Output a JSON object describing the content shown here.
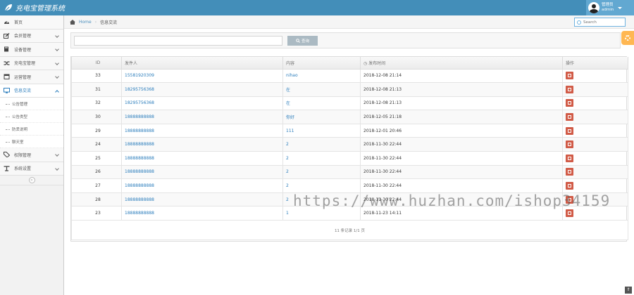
{
  "navbar": {
    "brand": "充电宝管理系统",
    "user_role": "管理员",
    "user_name": "admin"
  },
  "sidebar": {
    "items": [
      {
        "label": "首页",
        "icon": "dashboard-icon",
        "has_children": false
      },
      {
        "label": "会员管理",
        "icon": "edit-icon",
        "has_children": true
      },
      {
        "label": "设备管理",
        "icon": "book-icon",
        "has_children": true
      },
      {
        "label": "充电宝管理",
        "icon": "shuffle-icon",
        "has_children": true
      },
      {
        "label": "运营管理",
        "icon": "calendar-icon",
        "has_children": true
      },
      {
        "label": "信息交流",
        "icon": "desktop-icon",
        "has_children": true,
        "active": true
      }
    ],
    "subitems": [
      "公告管理",
      "公告类型",
      "防丢说明",
      "聊天室"
    ],
    "items_after": [
      {
        "label": "权限管理",
        "icon": "tag-icon",
        "has_children": true
      },
      {
        "label": "系统设置",
        "icon": "user-cog-icon",
        "has_children": true
      }
    ],
    "collapse_glyph": "«"
  },
  "breadcrumb": {
    "home": "Home",
    "separator": "›",
    "current": "信息交流"
  },
  "search": {
    "placeholder": "Search"
  },
  "toolbar": {
    "input_value": "",
    "query_label": "查询"
  },
  "table": {
    "columns": [
      "ID",
      "发件人",
      "内容",
      "发布时间",
      "操作"
    ],
    "rows": [
      {
        "id": "33",
        "sender": "15581920309",
        "content": "nihao",
        "time": "2018-12-08 21:14"
      },
      {
        "id": "31",
        "sender": "18295756368",
        "content": "在",
        "time": "2018-12-08 21:13"
      },
      {
        "id": "32",
        "sender": "18295756368",
        "content": "在",
        "time": "2018-12-08 21:13"
      },
      {
        "id": "30",
        "sender": "18888888888",
        "content": "你好",
        "time": "2018-12-05 21:18"
      },
      {
        "id": "29",
        "sender": "18888888888",
        "content": "111",
        "time": "2018-12-01 20:46"
      },
      {
        "id": "24",
        "sender": "18888888888",
        "content": "2",
        "time": "2018-11-30 22:44"
      },
      {
        "id": "25",
        "sender": "18888888888",
        "content": "2",
        "time": "2018-11-30 22:44"
      },
      {
        "id": "26",
        "sender": "18888888888",
        "content": "2",
        "time": "2018-11-30 22:44"
      },
      {
        "id": "27",
        "sender": "18888888888",
        "content": "2",
        "time": "2018-11-30 22:44"
      },
      {
        "id": "28",
        "sender": "18888888888",
        "content": "2",
        "time": "2018-11-30 22:44"
      },
      {
        "id": "23",
        "sender": "18888888888",
        "content": "1",
        "time": "2018-11-23 14:11"
      }
    ],
    "footer": "11 条记录 1/1 页"
  },
  "watermark": "https://www.huzhan.com/ishop34159",
  "scroll_top_glyph": "⇑",
  "colors": {
    "navbar": "#438eb9",
    "link": "#2b7dbc",
    "delete": "#d15b47",
    "settings": "#ffb752"
  }
}
